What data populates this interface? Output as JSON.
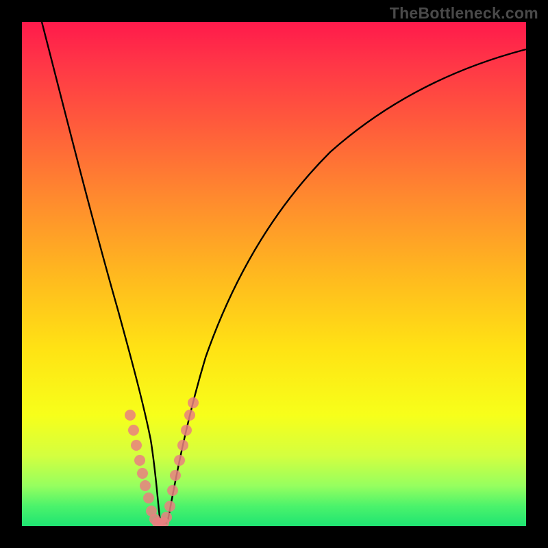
{
  "watermark": "TheBottleneck.com",
  "chart_data": {
    "type": "line",
    "title": "",
    "xlabel": "",
    "ylabel": "",
    "xlim": [
      0,
      100
    ],
    "ylim": [
      0,
      100
    ],
    "grid": false,
    "legend": false,
    "series": [
      {
        "name": "bottleneck-curve",
        "x": [
          4,
          8,
          12,
          16,
          18,
          20,
          22,
          23.5,
          25,
          26,
          27,
          27.5,
          28,
          28.5,
          30,
          32,
          36,
          40,
          46,
          54,
          64,
          76,
          90,
          100
        ],
        "y": [
          100,
          80,
          60,
          42,
          34,
          26,
          18,
          12,
          6,
          2,
          0,
          0,
          0,
          2,
          8,
          16,
          30,
          40,
          52,
          62,
          72,
          80,
          86,
          90
        ]
      }
    ],
    "scatter_points": {
      "name": "highlighted-dots",
      "points": [
        {
          "x": 21.5,
          "y": 22
        },
        {
          "x": 22.1,
          "y": 19
        },
        {
          "x": 22.7,
          "y": 16
        },
        {
          "x": 23.3,
          "y": 13
        },
        {
          "x": 23.9,
          "y": 10.5
        },
        {
          "x": 24.5,
          "y": 8
        },
        {
          "x": 25.1,
          "y": 5.5
        },
        {
          "x": 25.7,
          "y": 3
        },
        {
          "x": 26.3,
          "y": 1.4
        },
        {
          "x": 26.9,
          "y": 0.6
        },
        {
          "x": 27.5,
          "y": 0.4
        },
        {
          "x": 28.1,
          "y": 0.6
        },
        {
          "x": 28.7,
          "y": 1.8
        },
        {
          "x": 29.3,
          "y": 4
        },
        {
          "x": 29.9,
          "y": 7
        },
        {
          "x": 30.5,
          "y": 10
        },
        {
          "x": 31.2,
          "y": 13
        },
        {
          "x": 31.9,
          "y": 16
        },
        {
          "x": 32.6,
          "y": 19
        },
        {
          "x": 33.3,
          "y": 22
        },
        {
          "x": 34.0,
          "y": 24.5
        }
      ]
    },
    "background_gradient": {
      "top": "#ff1a4b",
      "bottom": "#1fe472",
      "description": "red-orange-yellow-green top-to-bottom gradient"
    }
  }
}
